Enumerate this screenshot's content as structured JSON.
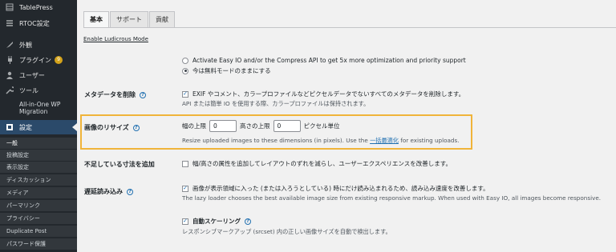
{
  "sidebar": {
    "items": [
      {
        "label": "TablePress",
        "icon": "table-icon"
      },
      {
        "label": "RTOC設定",
        "icon": "list-icon"
      },
      {
        "label": "外観",
        "icon": "brush-icon"
      },
      {
        "label": "プラグイン",
        "icon": "plug-icon",
        "badge": "9"
      },
      {
        "label": "ユーザー",
        "icon": "user-icon"
      },
      {
        "label": "ツール",
        "icon": "wrench-icon"
      },
      {
        "label": "All-in-One WP Migration",
        "icon": "migration-icon"
      },
      {
        "label": "設定",
        "icon": "settings-icon"
      }
    ],
    "subitems": [
      "一般",
      "投稿設定",
      "表示設定",
      "ディスカッション",
      "メディア",
      "パーマリンク",
      "プライバシー",
      "Duplicate Post",
      "パスワード保護"
    ]
  },
  "tabs": [
    "基本",
    "サポート",
    "貢献"
  ],
  "ludicrous_link": "Enable Ludicrous Mode",
  "compress": {
    "option1": "Activate Easy IO and/or the Compress API to get 5x more optimization and priority support",
    "option2": "今は無料モードのままにする"
  },
  "metadata": {
    "label": "メタデータを削除",
    "checkbox": "EXIF やコメント、カラープロファイルなどピクセルデータでないすべてのメタデータを削除します。",
    "desc": "API または簡単 IO を使用する際、カラープロファイルは保持されます。"
  },
  "resize": {
    "label": "画像のリサイズ",
    "width_label": "幅の上限",
    "width_value": "0",
    "height_label": "高さの上限",
    "height_value": "0",
    "unit": "ピクセル単位",
    "desc_before": "Resize uploaded images to these dimensions (in pixels). Use the",
    "desc_link": "一括最適化",
    "desc_after": "for existing uploads."
  },
  "dimensions": {
    "label": "不足している寸法を追加",
    "checkbox": "幅/高さの属性を追加してレイアウトのずれを減らし、ユーザーエクスペリエンスを改善します。"
  },
  "lazy": {
    "label": "遅延読み込み",
    "checkbox": "画像が表示領域に入った (または入ろうとしている) 時にだけ読み込まれるため、読み込み速度を改善します。",
    "desc": "The lazy loader chooses the best available image size from existing responsive markup. When used with Easy IO, all images become responsive."
  },
  "autoscale": {
    "checkbox": "自動スケーリング",
    "desc": "レスポンシブマークアップ (srcset) 内の正しい画像サイズを自動で検出します。"
  },
  "colors": {
    "accent": "#2271b1",
    "highlight": "#f0b43a",
    "sidebar": "#23282d"
  }
}
